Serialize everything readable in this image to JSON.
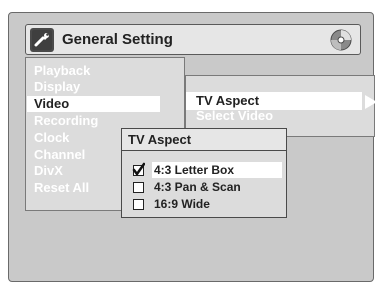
{
  "title": "General Setting",
  "icons": {
    "title_left": "wrench-icon",
    "title_right": "disc-icon",
    "submenu_arrow": "arrow-right-icon",
    "option_check": "checkmark-icon"
  },
  "main_menu": {
    "items": [
      "Playback",
      "Display",
      "Video",
      "Recording",
      "Clock",
      "Channel",
      "DivX",
      "Reset All"
    ],
    "selected": "Video"
  },
  "sub_menu": {
    "items": [
      "TV Aspect",
      "Select Video"
    ],
    "selected": "TV Aspect"
  },
  "popup": {
    "title": "TV Aspect",
    "options": [
      {
        "label": "4:3 Letter Box",
        "checked": true
      },
      {
        "label": "4:3 Pan & Scan",
        "checked": false
      },
      {
        "label": "16:9 Wide",
        "checked": false
      }
    ]
  }
}
